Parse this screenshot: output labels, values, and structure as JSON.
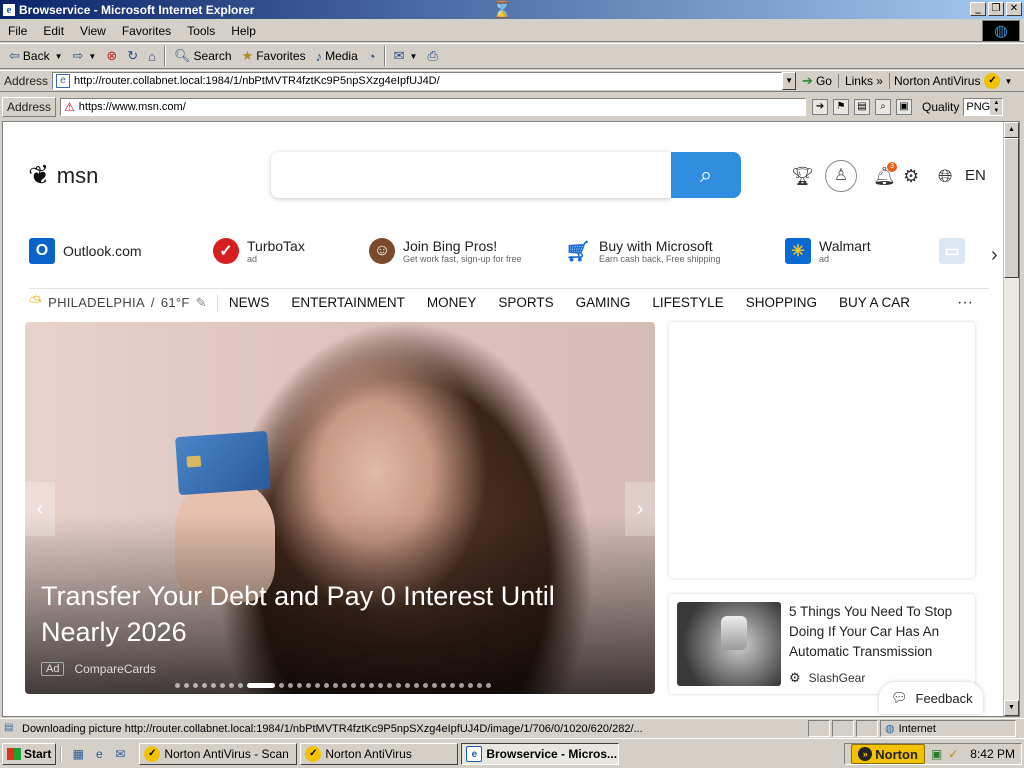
{
  "window": {
    "title": "Browservice - Microsoft Internet Explorer"
  },
  "menu": [
    "File",
    "Edit",
    "View",
    "Favorites",
    "Tools",
    "Help"
  ],
  "toolbar": {
    "back": "Back",
    "search": "Search",
    "favorites": "Favorites",
    "media": "Media"
  },
  "address_bar": {
    "label": "Address",
    "url": "http://router.collabnet.local:1984/1/nbPtMVTR4fztKc9P5npSXzg4eIpfUJ4D/",
    "go": "Go",
    "links": "Links",
    "norton": "Norton AntiVirus"
  },
  "inner_address_bar": {
    "label": "Address",
    "url": "https://www.msn.com/",
    "quality_label": "Quality",
    "quality_value": "PNG"
  },
  "page": {
    "logo_text": "msn",
    "notification_count": "3",
    "language": "EN",
    "shortcuts": [
      {
        "title": "Outlook.com",
        "sub": "",
        "icon": "outlook-icon",
        "color": "#0a64c8"
      },
      {
        "title": "TurboTax",
        "sub": "ad",
        "icon": "turbotax-icon",
        "color": "#d62020"
      },
      {
        "title": "Join Bing Pros!",
        "sub": "Get work fast, sign-up for free",
        "icon": "bing-pros-icon",
        "color": "#7a4a2a"
      },
      {
        "title": "Buy with Microsoft",
        "sub": "Earn cash back, Free shipping",
        "icon": "cart-icon",
        "color": "#1a6ad8"
      },
      {
        "title": "Walmart",
        "sub": "ad",
        "icon": "walmart-icon",
        "color": "#0a6ad0"
      }
    ],
    "weather": {
      "location": "PHILADELPHIA",
      "temp": "61°F"
    },
    "nav": [
      "NEWS",
      "ENTERTAINMENT",
      "MONEY",
      "SPORTS",
      "GAMING",
      "LIFESTYLE",
      "SHOPPING",
      "BUY A CAR"
    ],
    "hero": {
      "headline": "Transfer Your Debt and Pay 0 Interest Until Nearly 2026",
      "ad_label": "Ad",
      "source": "CompareCards"
    },
    "story": {
      "title": "5 Things You Need To Stop Doing If Your Car Has An Automatic Transmission",
      "source": "SlashGear"
    },
    "feedback": "Feedback"
  },
  "status": {
    "text": "Downloading picture http://router.collabnet.local:1984/1/nbPtMVTR4fztKc9P5npSXzg4eIpfUJ4D/image/1/706/0/1020/620/282/...",
    "zone": "Internet"
  },
  "taskbar": {
    "start": "Start",
    "tasks": [
      "Norton AntiVirus - Scan",
      "Norton AntiVirus",
      "Browservice - Micros..."
    ],
    "tray_norton": "Norton",
    "clock": "8:42 PM"
  }
}
